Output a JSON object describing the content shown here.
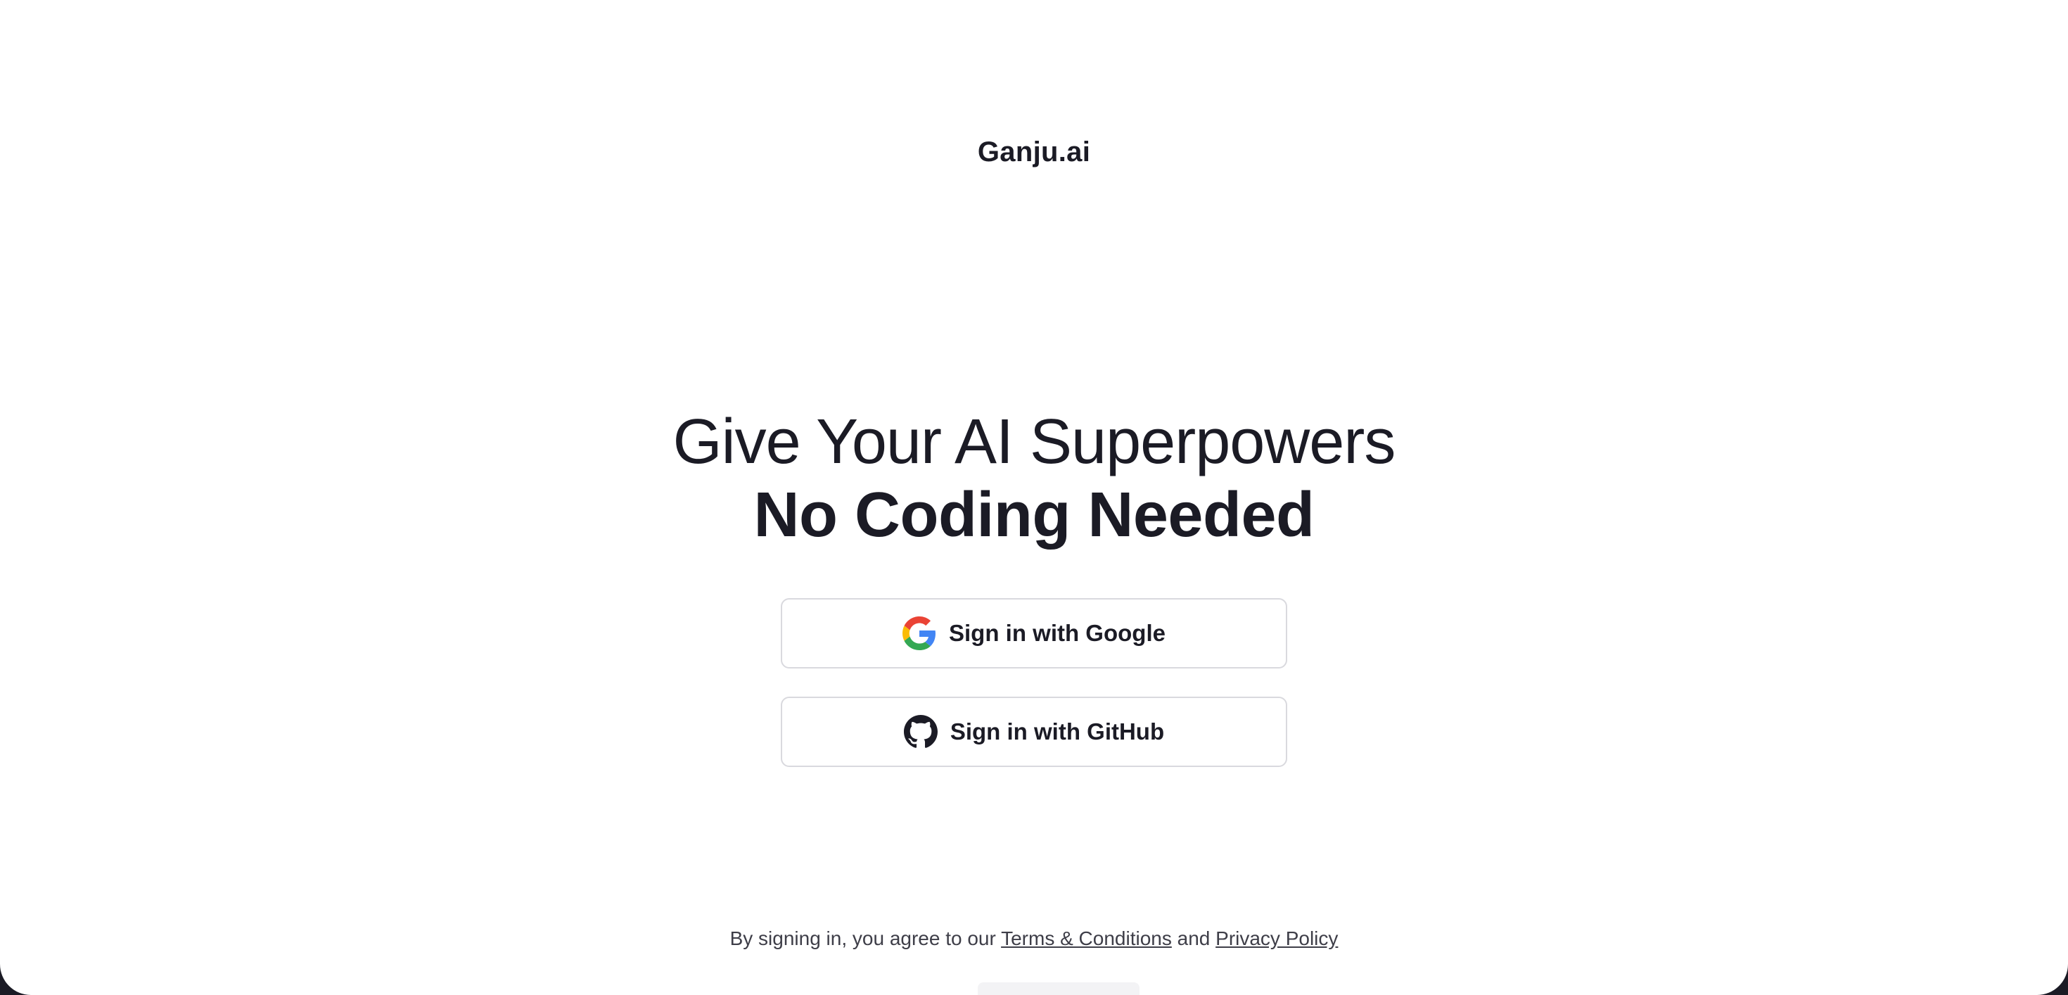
{
  "brand": {
    "name": "Ganju.ai"
  },
  "hero": {
    "line1": "Give Your AI Superpowers",
    "line2": "No Coding Needed"
  },
  "auth": {
    "google_label": "Sign in with Google",
    "github_label": "Sign in with GitHub",
    "google_icon": "google-g-icon",
    "github_icon": "github-octocat-icon"
  },
  "legal": {
    "prefix": "By signing in, you agree to our",
    "terms": "Terms & Conditions",
    "and": "and",
    "privacy": "Privacy Policy"
  },
  "colors": {
    "background": "#ffffff",
    "text": "#1b1b25",
    "border": "#d9d9de",
    "outer": "#1b1b25"
  }
}
